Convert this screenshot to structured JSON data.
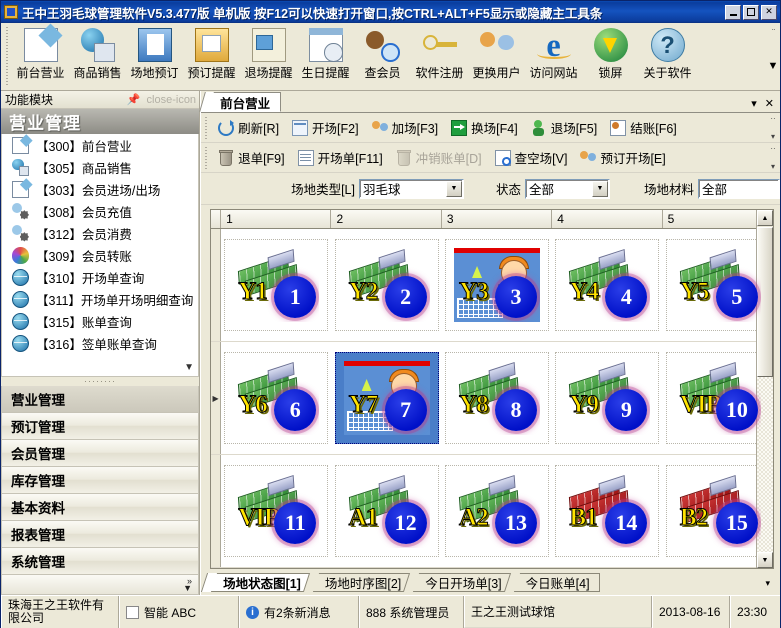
{
  "window": {
    "title": "王中王羽毛球管理软件V5.3.477版  单机版  按F12可以快速打开窗口,按CTRL+ALT+F5显示或隐藏主工具条",
    "minimize": "_",
    "maximize": "□",
    "close": "✕"
  },
  "main_toolbar": {
    "items": [
      {
        "label": "前台营业",
        "icon": "pencil-note-icon"
      },
      {
        "label": "商品销售",
        "icon": "globe-box-icon"
      },
      {
        "label": "场地预订",
        "icon": "book-blue-icon"
      },
      {
        "label": "预订提醒",
        "icon": "folder-bell-icon"
      },
      {
        "label": "退场提醒",
        "icon": "note-photo-icon"
      },
      {
        "label": "生日提醒",
        "icon": "calendar-clock-icon"
      },
      {
        "label": "查会员",
        "icon": "person-search-icon"
      },
      {
        "label": "软件注册",
        "icon": "key-icon"
      },
      {
        "label": "更换用户",
        "icon": "users-switch-icon"
      },
      {
        "label": "访问网站",
        "icon": "internet-explorer-icon"
      },
      {
        "label": "锁屏",
        "icon": "globe-download-icon"
      },
      {
        "label": "关于软件",
        "icon": "question-help-icon"
      }
    ],
    "overflow": "▼"
  },
  "sidebar": {
    "header": "功能模块",
    "pin_icon": "pin-icon",
    "close_icon": "close-icon",
    "group_title": "营业管理",
    "items": [
      {
        "label": "【300】前台营业",
        "icon": "pencil-note-icon"
      },
      {
        "label": "【305】商品销售",
        "icon": "globe-box-icon"
      },
      {
        "label": "【303】会员进场/出场",
        "icon": "pencil-note-icon"
      },
      {
        "label": "【308】会员充值",
        "icon": "person-gear-icon"
      },
      {
        "label": "【312】会员消费",
        "icon": "person-gear-icon"
      },
      {
        "label": "【309】会员转账",
        "icon": "palette-person-icon"
      },
      {
        "label": "【310】开场单查询",
        "icon": "globe-icon"
      },
      {
        "label": "【311】开场单开场明细查询",
        "icon": "globe-icon"
      },
      {
        "label": "【315】账单查询",
        "icon": "globe-icon"
      },
      {
        "label": "【316】签单账单查询",
        "icon": "globe-icon"
      }
    ],
    "list_more": "▼",
    "accordion": [
      {
        "label": "营业管理",
        "selected": true
      },
      {
        "label": "预订管理",
        "selected": false
      },
      {
        "label": "会员管理",
        "selected": false
      },
      {
        "label": "库存管理",
        "selected": false
      },
      {
        "label": "基本资料",
        "selected": false
      },
      {
        "label": "报表管理",
        "selected": false
      },
      {
        "label": "系统管理",
        "selected": false
      }
    ],
    "accordion_more": "»"
  },
  "doc": {
    "tab_label": "前台营业",
    "dropdown_icon": "▾",
    "close_icon": "✕"
  },
  "commands_row1": [
    {
      "label": "刷新[R]",
      "icon": "refresh-icon",
      "disabled": false
    },
    {
      "label": "开场[F2]",
      "icon": "open-court-icon",
      "disabled": false
    },
    {
      "label": "加场[F3]",
      "icon": "add-court-icon",
      "disabled": false
    },
    {
      "label": "换场[F4]",
      "icon": "swap-court-icon",
      "disabled": false
    },
    {
      "label": "退场[F5]",
      "icon": "leave-court-icon",
      "disabled": false
    },
    {
      "label": "结账[F6]",
      "icon": "checkout-icon",
      "disabled": false
    }
  ],
  "commands_row2": [
    {
      "label": "退单[F9]",
      "icon": "trash-icon",
      "disabled": false
    },
    {
      "label": "开场单[F11]",
      "icon": "document-icon",
      "disabled": false
    },
    {
      "label": "冲销账单[D]",
      "icon": "trash-icon",
      "disabled": true
    },
    {
      "label": "查空场[V]",
      "icon": "document-search-icon",
      "disabled": false
    },
    {
      "label": "预订开场[E]",
      "icon": "users-icon",
      "disabled": false
    }
  ],
  "filters": {
    "type_label": "场地类型[L]",
    "type_value": "羽毛球",
    "status_label": "状态",
    "status_value": "全部",
    "material_label": "场地材料",
    "material_value": "全部"
  },
  "grid": {
    "columns": [
      "1",
      "2",
      "3",
      "4",
      "5"
    ],
    "rows": [
      {
        "selected": false,
        "cells": [
          {
            "name": "Y1",
            "num": "1",
            "state": "free",
            "material": "green"
          },
          {
            "name": "Y2",
            "num": "2",
            "state": "free",
            "material": "green"
          },
          {
            "name": "Y3",
            "num": "3",
            "state": "occupied",
            "material": "green"
          },
          {
            "name": "Y4",
            "num": "4",
            "state": "free",
            "material": "green"
          },
          {
            "name": "Y5",
            "num": "5",
            "state": "free",
            "material": "green"
          }
        ]
      },
      {
        "selected": true,
        "cells": [
          {
            "name": "Y6",
            "num": "6",
            "state": "free",
            "material": "green"
          },
          {
            "name": "Y7",
            "num": "7",
            "state": "occupied",
            "material": "green",
            "selected": true
          },
          {
            "name": "Y8",
            "num": "8",
            "state": "free",
            "material": "green"
          },
          {
            "name": "Y9",
            "num": "9",
            "state": "free",
            "material": "green"
          },
          {
            "name": "VIP1",
            "num": "10",
            "state": "free",
            "material": "green"
          }
        ]
      },
      {
        "selected": false,
        "cells": [
          {
            "name": "VIP2",
            "num": "11",
            "state": "free",
            "material": "green"
          },
          {
            "name": "A1",
            "num": "12",
            "state": "free",
            "material": "green"
          },
          {
            "name": "A2",
            "num": "13",
            "state": "free",
            "material": "green"
          },
          {
            "name": "B1",
            "num": "14",
            "state": "free",
            "material": "red"
          },
          {
            "name": "B2",
            "num": "15",
            "state": "free",
            "material": "red"
          }
        ]
      }
    ],
    "scroll_up": "▲",
    "scroll_down": "▼"
  },
  "bottom_tabs": [
    {
      "label": "场地状态图[1]",
      "active": true
    },
    {
      "label": "场地时序图[2]",
      "active": false
    },
    {
      "label": "今日开场单[3]",
      "active": false
    },
    {
      "label": "今日账单[4]",
      "active": false
    }
  ],
  "bottom_tabs_more": "▾",
  "status_bar": {
    "company": "珠海王之王软件有限公司",
    "ime": "智能 ABC",
    "ime_icon": "ime-icon",
    "messages": "有2条新消息",
    "messages_icon": "info-icon",
    "operator": "888 系统管理员",
    "venue": "王之王测试球馆",
    "date": "2013-08-16",
    "time": "23:30"
  }
}
